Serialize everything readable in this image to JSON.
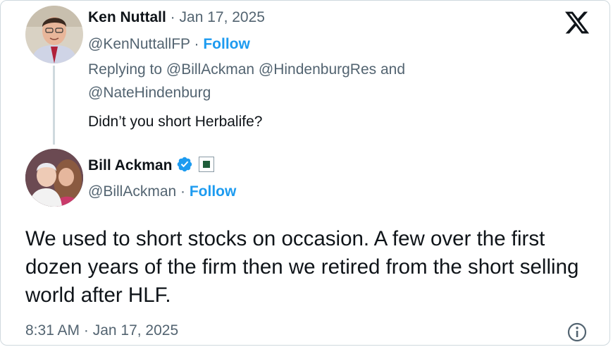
{
  "reply": {
    "author_name": "Ken Nuttall",
    "date": "Jan 17, 2025",
    "handle": "@KenNuttallFP",
    "follow_label": "Follow",
    "replying_line1": "Replying to @BillAckman @HindenburgRes and",
    "replying_line2": "@NateHindenburg",
    "text": "Didn’t you short Herbalife?"
  },
  "main": {
    "author_name": "Bill Ackman",
    "handle": "@BillAckman",
    "follow_label": "Follow",
    "text": "We used to short stocks on occasion. A few over the first dozen years of the firm then we retired from the short selling world after HLF.",
    "timestamp": "8:31 AM · Jan 17, 2025"
  },
  "icons": {
    "logo": "x-logo-icon",
    "verified": "verified-badge-icon",
    "affiliation": "affiliation-badge-icon",
    "info": "info-icon"
  },
  "colors": {
    "accent": "#1d9bf0",
    "muted": "#536471",
    "text": "#0f1419"
  }
}
